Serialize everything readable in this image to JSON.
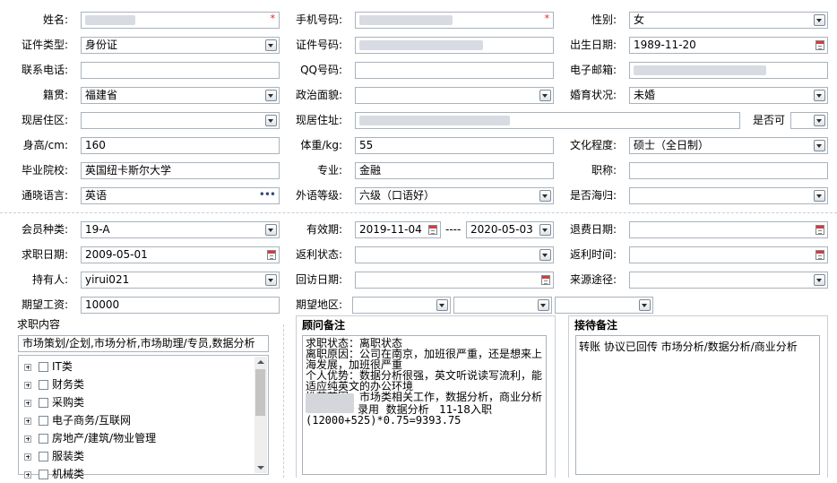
{
  "form": {
    "name_label": "姓名:",
    "phone_label": "手机号码:",
    "gender_label": "性别:",
    "gender_value": "女",
    "id_type_label": "证件类型:",
    "id_type_value": "身份证",
    "id_no_label": "证件号码:",
    "birth_label": "出生日期:",
    "birth_value": "1989-11-20",
    "contact_label": "联系电话:",
    "qq_label": "QQ号码:",
    "email_label": "电子邮箱:",
    "native_label": "籍贯:",
    "native_value": "福建省",
    "political_label": "政治面貌:",
    "marital_label": "婚育状况:",
    "marital_value": "未婚",
    "region_label": "现居住区:",
    "address_label": "现居住址:",
    "ok_label": "是否可",
    "height_label": "身高/cm:",
    "height_value": "160",
    "weight_label": "体重/kg:",
    "weight_value": "55",
    "edu_label": "文化程度:",
    "edu_value": "硕士（全日制）",
    "school_label": "毕业院校:",
    "school_value": "英国纽卡斯尔大学",
    "major_label": "专业:",
    "major_value": "金融",
    "title_label": "职称:",
    "lang_label": "通晓语言:",
    "lang_value": "英语",
    "foreign_label": "外语等级:",
    "foreign_value": "六级（口语好）",
    "returnee_label": "是否海归:",
    "member_label": "会员种类:",
    "member_value": "19-A",
    "valid_label": "有效期:",
    "valid_from": "2019-11-04",
    "valid_dash": "----",
    "valid_to": "2020-05-03",
    "refund_label": "退费日期:",
    "jobdate_label": "求职日期:",
    "jobdate_value": "2009-05-01",
    "rebate_status_label": "返利状态:",
    "rebate_time_label": "返利时间:",
    "holder_label": "持有人:",
    "holder_value": "yirui021",
    "visit_label": "回访日期:",
    "source_label": "来源途径:",
    "salary_label": "期望工资:",
    "salary_value": "10000",
    "area_label": "期望地区:"
  },
  "job": {
    "section_title": "求职内容",
    "summary": "市场策划/企划,市场分析,市场助理/专员,数据分析",
    "tree": [
      "IT类",
      "财务类",
      "采购类",
      "电子商务/互联网",
      "房地产/建筑/物业管理",
      "服装类",
      "机械类"
    ]
  },
  "consultant": {
    "title": "顾问备注",
    "lines": [
      "求职状态：离职状态",
      "离职原因：公司在南京，加班很严重，还是想来上",
      "海发展，加班很严重",
      "个人优势：数据分析很强，英文听说读写流利，能",
      "适应纯英文的办公环境",
      "推荐范围：市场类相关工作，数据分析，商业分析",
      "录用  数据分析   11-18入职",
      "(12000+525)*0.75=9393.75"
    ]
  },
  "reception": {
    "title": "接待备注",
    "text": "转账 协议已回传 市场分析/数据分析/商业分析"
  }
}
